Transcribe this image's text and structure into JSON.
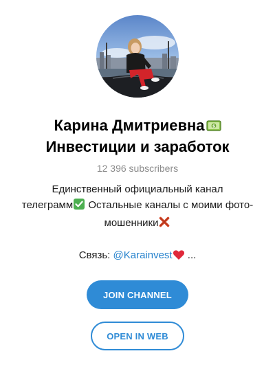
{
  "channel": {
    "avatar_icon": "channel-avatar-photo",
    "title_line1": "Карина Дмитриевна",
    "title_line2": "Инвестиции и заработок",
    "title_emoji": "money-bill-icon",
    "subscribers": "12 396 subscribers"
  },
  "description": {
    "line1": "Единственный официальный канал",
    "line2_text": "телеграмм",
    "line2_emoji": "check-mark-icon",
    "line2_rest": " Остальные каналы с моими фото-",
    "line3_text": "мошенники",
    "line3_emoji": "cross-mark-icon"
  },
  "contact": {
    "label": "Связь: ",
    "link": "@Karainvest",
    "emoji": "red-heart-icon",
    "ellipsis": " ..."
  },
  "buttons": {
    "join_label": "JOIN CHANNEL",
    "web_label": "OPEN IN WEB"
  },
  "colors": {
    "accent": "#2f8bd6",
    "link": "#2481cc",
    "muted": "#8a8a8a"
  }
}
